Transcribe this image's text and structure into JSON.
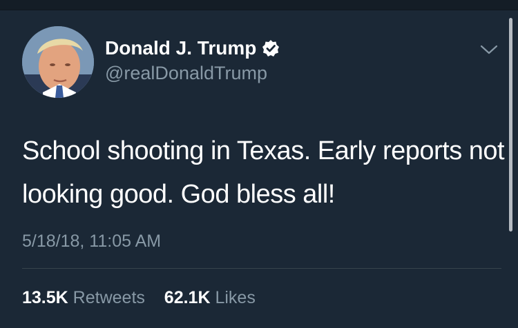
{
  "colors": {
    "background": "#1b2836",
    "text_primary": "#ffffff",
    "text_secondary": "#8899a6",
    "divider": "#38444d",
    "verified_badge": "#ffffff"
  },
  "user": {
    "display_name": "Donald J. Trump",
    "handle": "@realDonaldTrump",
    "verified": true,
    "avatar_icon": "profile-photo"
  },
  "tweet": {
    "text": "School shooting in Texas. Early reports not looking good. God bless all!",
    "timestamp": "5/18/18, 11:05 AM"
  },
  "stats": {
    "retweets_count": "13.5K",
    "retweets_label": "Retweets",
    "likes_count": "62.1K",
    "likes_label": "Likes"
  },
  "icons": {
    "menu": "chevron-down-icon",
    "verified": "verified-badge-icon"
  }
}
